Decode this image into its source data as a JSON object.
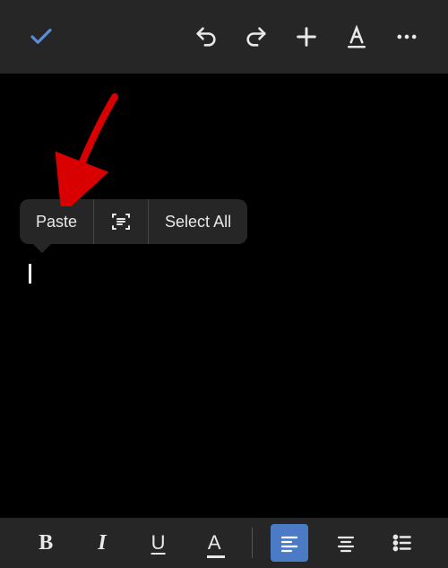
{
  "context_menu": {
    "paste_label": "Paste",
    "select_all_label": "Select All"
  },
  "toolbar_top": {
    "confirm": "check",
    "undo": "undo",
    "redo": "redo",
    "add": "add",
    "text_format": "text-format",
    "more": "more"
  },
  "toolbar_bottom": {
    "bold": "B",
    "italic": "I",
    "underline": "U",
    "font_color": "A"
  }
}
